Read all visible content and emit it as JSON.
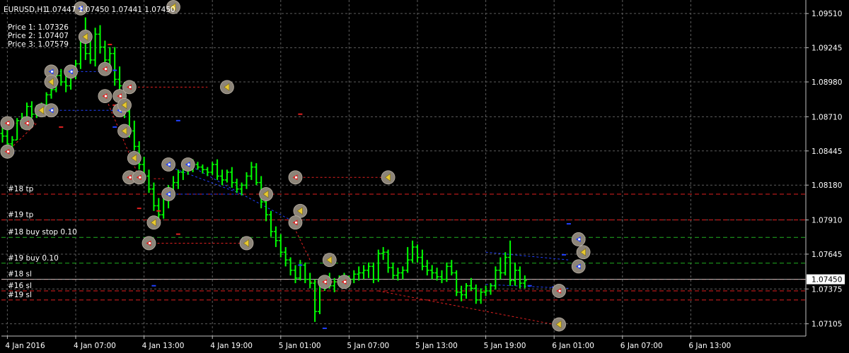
{
  "header": {
    "symbol": "EURUSD,H1",
    "ohlc": "1.07447 1.07450 1.07441 1.07450",
    "prices": [
      "Price 1: 1.07326",
      "Price 2: 1.07407",
      "Price 3: 1.07579"
    ]
  },
  "colors": {
    "background": "#000000",
    "bar": "#00ff00",
    "grid": "#5c5c5c",
    "axis": "#c0c0c0",
    "sell": "#e02020",
    "buy": "#2040ff",
    "pending": "#20b020",
    "marker_fill": "#8c8478"
  },
  "chart_data": {
    "type": "bar",
    "title": "EURUSD,H1",
    "ylim": [
      1.0701,
      1.09615
    ],
    "y_ticks": [
      1.0951,
      1.09245,
      1.0898,
      1.0871,
      1.08445,
      1.0818,
      1.0791,
      1.07645,
      1.07375,
      1.07105
    ],
    "y_tick_labels": [
      "1.09510",
      "1.09245",
      "1.08980",
      "1.08710",
      "1.08445",
      "1.08180",
      "1.07910",
      "1.07645",
      "1.07375",
      "1.07105"
    ],
    "current_price": 1.0745,
    "current_price_label": "1.07450",
    "x_ticks": [
      1,
      15,
      29,
      43,
      57,
      71,
      85,
      99,
      113,
      127,
      141
    ],
    "x_tick_labels": [
      "4 Jan 2016",
      "4 Jan 07:00",
      "4 Jan 13:00",
      "4 Jan 19:00",
      "5 Jan 01:00",
      "5 Jan 07:00",
      "5 Jan 13:00",
      "5 Jan 19:00",
      "6 Jan 01:00",
      "6 Jan 07:00",
      "6 Jan 13:00"
    ],
    "grid": true,
    "bars": [
      [
        1.0858,
        1.0864,
        1.0851,
        1.0856
      ],
      [
        1.0856,
        1.0864,
        1.0848,
        1.085
      ],
      [
        1.085,
        1.0856,
        1.0846,
        1.0853
      ],
      [
        1.0853,
        1.087,
        1.0853,
        1.0868
      ],
      [
        1.0868,
        1.0874,
        1.0862,
        1.0866
      ],
      [
        1.0866,
        1.0882,
        1.0863,
        1.0879
      ],
      [
        1.0879,
        1.0883,
        1.087,
        1.0873
      ],
      [
        1.0873,
        1.088,
        1.087,
        1.0878
      ],
      [
        1.0878,
        1.0882,
        1.0875,
        1.0877
      ],
      [
        1.0877,
        1.089,
        1.0876,
        1.0888
      ],
      [
        1.0888,
        1.0895,
        1.0885,
        1.0892
      ],
      [
        1.0892,
        1.0906,
        1.089,
        1.0903
      ],
      [
        1.0903,
        1.0908,
        1.0895,
        1.0898
      ],
      [
        1.0898,
        1.0903,
        1.089,
        1.0895
      ],
      [
        1.0895,
        1.0908,
        1.0892,
        1.0905
      ],
      [
        1.0905,
        1.0915,
        1.09,
        1.0912
      ],
      [
        1.0912,
        1.0935,
        1.0908,
        1.093
      ],
      [
        1.093,
        1.0948,
        1.0915,
        1.092
      ],
      [
        1.092,
        1.0932,
        1.0912,
        1.0915
      ],
      [
        1.0915,
        1.094,
        1.091,
        1.0935
      ],
      [
        1.0935,
        1.0942,
        1.092,
        1.0925
      ],
      [
        1.0925,
        1.093,
        1.091,
        1.0915
      ],
      [
        1.0915,
        1.0925,
        1.0905,
        1.092
      ],
      [
        1.092,
        1.0925,
        1.0895,
        1.09
      ],
      [
        1.09,
        1.091,
        1.089,
        1.0895
      ],
      [
        1.0895,
        1.0898,
        1.087,
        1.0875
      ],
      [
        1.0875,
        1.088,
        1.0855,
        1.086
      ],
      [
        1.086,
        1.0868,
        1.0845,
        1.0848
      ],
      [
        1.0848,
        1.0852,
        1.083,
        1.0834
      ],
      [
        1.0834,
        1.084,
        1.082,
        1.0825
      ],
      [
        1.0825,
        1.083,
        1.0812,
        1.0815
      ],
      [
        1.0815,
        1.082,
        1.0798,
        1.0802
      ],
      [
        1.0802,
        1.0808,
        1.079,
        1.0795
      ],
      [
        1.0795,
        1.0812,
        1.0792,
        1.0808
      ],
      [
        1.0808,
        1.0818,
        1.08,
        1.0812
      ],
      [
        1.0812,
        1.0825,
        1.0808,
        1.082
      ],
      [
        1.082,
        1.083,
        1.0815,
        1.0828
      ],
      [
        1.0828,
        1.0834,
        1.0822,
        1.083
      ],
      [
        1.083,
        1.0835,
        1.0826,
        1.0832
      ],
      [
        1.0832,
        1.0838,
        1.0828,
        1.0834
      ],
      [
        1.0834,
        1.0836,
        1.083,
        1.0832
      ],
      [
        1.0832,
        1.0834,
        1.0827,
        1.083
      ],
      [
        1.083,
        1.0832,
        1.0825,
        1.0828
      ],
      [
        1.0828,
        1.0836,
        1.0826,
        1.0834
      ],
      [
        1.0834,
        1.0838,
        1.0822,
        1.0825
      ],
      [
        1.0825,
        1.083,
        1.0818,
        1.0822
      ],
      [
        1.0822,
        1.083,
        1.082,
        1.0828
      ],
      [
        1.0828,
        1.0832,
        1.0816,
        1.082
      ],
      [
        1.082,
        1.0823,
        1.0812,
        1.0815
      ],
      [
        1.0815,
        1.082,
        1.081,
        1.0818
      ],
      [
        1.0818,
        1.0828,
        1.0815,
        1.0825
      ],
      [
        1.0825,
        1.0836,
        1.0822,
        1.0832
      ],
      [
        1.0832,
        1.0835,
        1.0818,
        1.082
      ],
      [
        1.082,
        1.0825,
        1.08,
        1.0805
      ],
      [
        1.0805,
        1.081,
        1.079,
        1.0795
      ],
      [
        1.0795,
        1.0798,
        1.0778,
        1.0782
      ],
      [
        1.0782,
        1.0786,
        1.077,
        1.0775
      ],
      [
        1.0775,
        1.078,
        1.0762,
        1.0766
      ],
      [
        1.0766,
        1.077,
        1.0755,
        1.076
      ],
      [
        1.076,
        1.0762,
        1.0748,
        1.0752
      ],
      [
        1.0752,
        1.0756,
        1.0742,
        1.0746
      ],
      [
        1.0746,
        1.076,
        1.0744,
        1.0756
      ],
      [
        1.0756,
        1.0758,
        1.0742,
        1.0745
      ],
      [
        1.0745,
        1.075,
        1.0738,
        1.0742
      ],
      [
        1.0742,
        1.0745,
        1.0712,
        1.072
      ],
      [
        1.072,
        1.0745,
        1.0718,
        1.0742
      ],
      [
        1.0742,
        1.0748,
        1.0736,
        1.0744
      ],
      [
        1.0744,
        1.075,
        1.0738,
        1.074
      ],
      [
        1.074,
        1.0746,
        1.0735,
        1.0743
      ],
      [
        1.0743,
        1.0748,
        1.074,
        1.0746
      ],
      [
        1.0746,
        1.075,
        1.0738,
        1.0742
      ],
      [
        1.0742,
        1.0748,
        1.0739,
        1.0745
      ],
      [
        1.0745,
        1.0752,
        1.0742,
        1.0749
      ],
      [
        1.0749,
        1.0755,
        1.0744,
        1.075
      ],
      [
        1.075,
        1.0756,
        1.0745,
        1.0752
      ],
      [
        1.0752,
        1.0758,
        1.0746,
        1.0755
      ],
      [
        1.0755,
        1.0758,
        1.0742,
        1.0745
      ],
      [
        1.0745,
        1.0768,
        1.0743,
        1.0765
      ],
      [
        1.0765,
        1.077,
        1.076,
        1.0766
      ],
      [
        1.0766,
        1.0768,
        1.075,
        1.0754
      ],
      [
        1.0754,
        1.0758,
        1.0745,
        1.0748
      ],
      [
        1.0748,
        1.0754,
        1.0744,
        1.075
      ],
      [
        1.075,
        1.0755,
        1.0745,
        1.0752
      ],
      [
        1.0752,
        1.077,
        1.075,
        1.076
      ],
      [
        1.076,
        1.0775,
        1.0758,
        1.077
      ],
      [
        1.077,
        1.0772,
        1.0758,
        1.0762
      ],
      [
        1.0762,
        1.0768,
        1.0752,
        1.0755
      ],
      [
        1.0755,
        1.076,
        1.0748,
        1.0752
      ],
      [
        1.0752,
        1.0756,
        1.0745,
        1.075
      ],
      [
        1.075,
        1.0754,
        1.0744,
        1.0747
      ],
      [
        1.0747,
        1.0752,
        1.0742,
        1.0745
      ],
      [
        1.0745,
        1.0758,
        1.0743,
        1.0755
      ],
      [
        1.0755,
        1.076,
        1.0748,
        1.075
      ],
      [
        1.075,
        1.0752,
        1.0732,
        1.0735
      ],
      [
        1.0735,
        1.074,
        1.0728,
        1.0733
      ],
      [
        1.0733,
        1.0742,
        1.073,
        1.074
      ],
      [
        1.074,
        1.0746,
        1.0736,
        1.0738
      ],
      [
        1.0738,
        1.0741,
        1.0726,
        1.0729
      ],
      [
        1.0729,
        1.0738,
        1.0726,
        1.0735
      ],
      [
        1.0735,
        1.074,
        1.0732,
        1.0736
      ],
      [
        1.0736,
        1.0742,
        1.0733,
        1.074
      ],
      [
        1.074,
        1.0755,
        1.0737,
        1.0752
      ],
      [
        1.0752,
        1.0762,
        1.0745,
        1.075
      ],
      [
        1.075,
        1.0766,
        1.0748,
        1.0762
      ],
      [
        1.0762,
        1.0775,
        1.074,
        1.0744
      ],
      [
        1.0744,
        1.0758,
        1.074,
        1.0752
      ],
      [
        1.0752,
        1.0755,
        1.0738,
        1.0742
      ],
      [
        1.0742,
        1.0748,
        1.0738,
        1.0744
      ]
    ],
    "lines": [
      {
        "label": "#18 tp",
        "price": 1.0811,
        "style": "sell"
      },
      {
        "label": "#19 tp",
        "price": 1.0791,
        "style": "sell"
      },
      {
        "label": "#18 buy stop 0.10",
        "price": 1.07775,
        "style": "pending"
      },
      {
        "label": "#19 buy 0.10",
        "price": 1.07575,
        "style": "pending"
      },
      {
        "label": "#18 sl",
        "price": 1.0745,
        "style": "sell"
      },
      {
        "label": "#16 sl",
        "price": 1.0736,
        "style": "sell"
      },
      {
        "label": "#19 sl",
        "price": 1.0729,
        "style": "sell"
      }
    ],
    "order_links": [
      {
        "from": [
          1,
          1.0866
        ],
        "to": [
          7,
          1.0866
        ],
        "style": "sell"
      },
      {
        "from": [
          1,
          1.0844
        ],
        "to": [
          7,
          1.0866
        ],
        "style": "sell"
      },
      {
        "from": [
          10,
          1.0906
        ],
        "to": [
          22,
          1.0906
        ],
        "style": "buy"
      },
      {
        "from": [
          10,
          1.0876
        ],
        "to": [
          24,
          1.0876
        ],
        "style": "buy"
      },
      {
        "from": [
          26,
          1.0894
        ],
        "to": [
          42,
          1.0894
        ],
        "style": "sell"
      },
      {
        "from": [
          21,
          1.0887
        ],
        "to": [
          28,
          1.0824
        ],
        "style": "sell"
      },
      {
        "from": [
          31,
          1.0823
        ],
        "to": [
          33,
          1.0823
        ],
        "style": "sell"
      },
      {
        "from": [
          33,
          1.0834
        ],
        "to": [
          49,
          1.0811
        ],
        "style": "buy"
      },
      {
        "from": [
          33,
          1.0811
        ],
        "to": [
          49,
          1.0811
        ],
        "style": "buy"
      },
      {
        "from": [
          38,
          1.0834
        ],
        "to": [
          49,
          1.0811
        ],
        "style": "buy"
      },
      {
        "from": [
          59,
          1.0824
        ],
        "to": [
          79,
          1.0824
        ],
        "style": "sell"
      },
      {
        "from": [
          30,
          1.0773
        ],
        "to": [
          49,
          1.0773
        ],
        "style": "sell"
      },
      {
        "from": [
          49,
          1.0811
        ],
        "to": [
          59,
          1.0791
        ],
        "style": "buy"
      },
      {
        "from": [
          59,
          1.0791
        ],
        "to": [
          63,
          1.076
        ],
        "style": "sell"
      },
      {
        "from": [
          63,
          1.0743
        ],
        "to": [
          69,
          1.0743
        ],
        "style": "sell"
      },
      {
        "from": [
          77,
          1.0736
        ],
        "to": [
          113,
          1.071
        ],
        "style": "sell"
      },
      {
        "from": [
          99,
          1.0766
        ],
        "to": [
          116,
          1.076
        ],
        "style": "buy"
      },
      {
        "from": [
          99,
          1.0741
        ],
        "to": [
          116,
          1.0738
        ],
        "style": "buy"
      }
    ],
    "markers": [
      {
        "index": 1,
        "price": 1.0866,
        "type": "sell"
      },
      {
        "index": 1,
        "price": 1.0844,
        "type": "sell"
      },
      {
        "index": 5,
        "price": 1.0866,
        "type": "sell"
      },
      {
        "index": 8,
        "price": 1.0876,
        "type": "close"
      },
      {
        "index": 10,
        "price": 1.0906,
        "type": "buy"
      },
      {
        "index": 10,
        "price": 1.0876,
        "type": "buy"
      },
      {
        "index": 10,
        "price": 1.0898,
        "type": "close"
      },
      {
        "index": 14,
        "price": 1.0906,
        "type": "buy"
      },
      {
        "index": 16,
        "price": 1.0955,
        "type": "buy"
      },
      {
        "index": 17,
        "price": 1.0933,
        "type": "close"
      },
      {
        "index": 21,
        "price": 1.0908,
        "type": "sell"
      },
      {
        "index": 21,
        "price": 1.0887,
        "type": "sell"
      },
      {
        "index": 24,
        "price": 1.0887,
        "type": "sell"
      },
      {
        "index": 24,
        "price": 1.0876,
        "type": "buy"
      },
      {
        "index": 25,
        "price": 1.088,
        "type": "close"
      },
      {
        "index": 26,
        "price": 1.0894,
        "type": "sell"
      },
      {
        "index": 25,
        "price": 1.086,
        "type": "close"
      },
      {
        "index": 27,
        "price": 1.0839,
        "type": "close"
      },
      {
        "index": 26,
        "price": 1.0824,
        "type": "sell"
      },
      {
        "index": 28,
        "price": 1.0824,
        "type": "sell"
      },
      {
        "index": 31,
        "price": 1.0789,
        "type": "close"
      },
      {
        "index": 30,
        "price": 1.0773,
        "type": "sell"
      },
      {
        "index": 34,
        "price": 1.0834,
        "type": "buy"
      },
      {
        "index": 34,
        "price": 1.0811,
        "type": "buy"
      },
      {
        "index": 38,
        "price": 1.0834,
        "type": "buy"
      },
      {
        "index": 35,
        "price": 1.0956,
        "type": "close"
      },
      {
        "index": 46,
        "price": 1.0894,
        "type": "close"
      },
      {
        "index": 50,
        "price": 1.0773,
        "type": "close"
      },
      {
        "index": 54,
        "price": 1.0811,
        "type": "close"
      },
      {
        "index": 60,
        "price": 1.0824,
        "type": "sell"
      },
      {
        "index": 61,
        "price": 1.0798,
        "type": "close"
      },
      {
        "index": 60,
        "price": 1.0789,
        "type": "sell"
      },
      {
        "index": 79,
        "price": 1.0824,
        "type": "close"
      },
      {
        "index": 67,
        "price": 1.076,
        "type": "close"
      },
      {
        "index": 66,
        "price": 1.0743,
        "type": "sell"
      },
      {
        "index": 70,
        "price": 1.0743,
        "type": "sell"
      },
      {
        "index": 114,
        "price": 1.0736,
        "type": "sell"
      },
      {
        "index": 114,
        "price": 1.071,
        "type": "close"
      },
      {
        "index": 118,
        "price": 1.0776,
        "type": "buy"
      },
      {
        "index": 119,
        "price": 1.0766,
        "type": "close"
      },
      {
        "index": 118,
        "price": 1.0755,
        "type": "buy"
      }
    ],
    "dashes": [
      {
        "index": 2,
        "price": 1.0843,
        "type": "buy"
      },
      {
        "index": 12,
        "price": 1.0863,
        "type": "sell"
      },
      {
        "index": 22,
        "price": 1.0927,
        "type": "sell"
      },
      {
        "index": 23,
        "price": 1.0907,
        "type": "buy"
      },
      {
        "index": 23,
        "price": 1.088,
        "type": "sell"
      },
      {
        "index": 23,
        "price": 1.0863,
        "type": "buy"
      },
      {
        "index": 28,
        "price": 1.08,
        "type": "sell"
      },
      {
        "index": 32,
        "price": 1.0798,
        "type": "sell"
      },
      {
        "index": 36,
        "price": 1.078,
        "type": "sell"
      },
      {
        "index": 36,
        "price": 1.0868,
        "type": "buy"
      },
      {
        "index": 61,
        "price": 1.0873,
        "type": "sell"
      },
      {
        "index": 61,
        "price": 1.0756,
        "type": "buy"
      },
      {
        "index": 66,
        "price": 1.0707,
        "type": "buy"
      },
      {
        "index": 31,
        "price": 1.074,
        "type": "buy"
      },
      {
        "index": 115,
        "price": 1.0764,
        "type": "buy"
      },
      {
        "index": 116,
        "price": 1.0788,
        "type": "buy"
      },
      {
        "index": 108,
        "price": 1.074,
        "type": "buy"
      },
      {
        "index": 113,
        "price": 1.0739,
        "type": "buy"
      }
    ]
  }
}
